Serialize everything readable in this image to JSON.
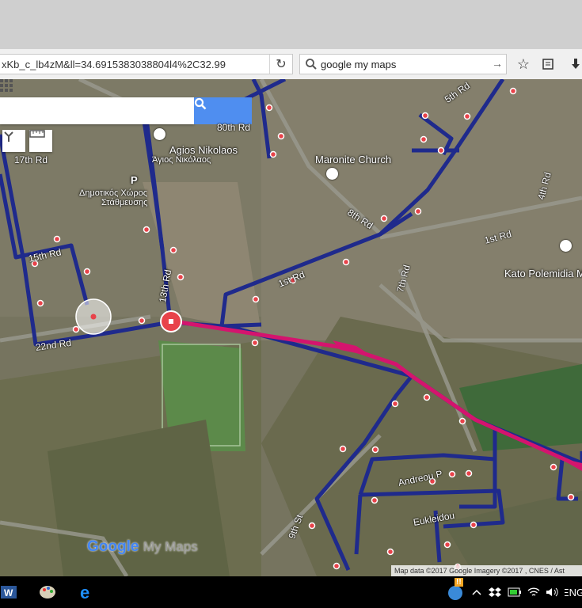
{
  "browser": {
    "url": "xKb_c_lb4zM&ll=34.6915383038804l4%2C32.99",
    "search_value": "google my maps",
    "icons": [
      "reload-icon",
      "search-icon",
      "go-arrow-icon",
      "star-icon",
      "reader-icon",
      "download-icon"
    ]
  },
  "map": {
    "search_placeholder": "",
    "places": {
      "agios_nikolaos_en": "Agios Nikolaos",
      "agios_nikolaos_gr": "Άγιος Νικόλαος",
      "parking_line1": "Δημοτικός Χώρος",
      "parking_line2": "Στάθμευσης",
      "parking_letter": "P",
      "maronite_church": "Maronite Church",
      "kato_polemidia": "Kato Polemidia M"
    },
    "roads": {
      "r5th": "5th Rd",
      "r80th": "80th Rd",
      "r17th": "17th Rd",
      "r4th": "4th Rd",
      "r8th": "8th Rd",
      "r1st": "1st Rd",
      "r7th": "7th Rd",
      "r15th": "15th Rd",
      "r13th": "13th Rd",
      "r1st_b": "1st Rd",
      "r22nd": "22nd Rd",
      "r9th": "9th St",
      "andreou": "Andreou P",
      "eukleidou": "Eukleidou"
    },
    "logo_word": "Google",
    "logo_suffix": "My Maps",
    "attribution": "Map data ©2017 Google Imagery ©2017 , CNES / Ast"
  },
  "taskbar": {
    "language": "ENG",
    "notification_badge": "!!",
    "icons": [
      "word-icon",
      "paint-icon",
      "edge-icon",
      "notification-icon",
      "chevron-up-icon",
      "dropbox-icon",
      "battery-icon",
      "wifi-icon",
      "volume-icon"
    ]
  },
  "colors": {
    "route": "#1f2a8c",
    "highlight": "#d4146e",
    "marker": "#e8434a",
    "search_btn": "#4f8ef0"
  }
}
